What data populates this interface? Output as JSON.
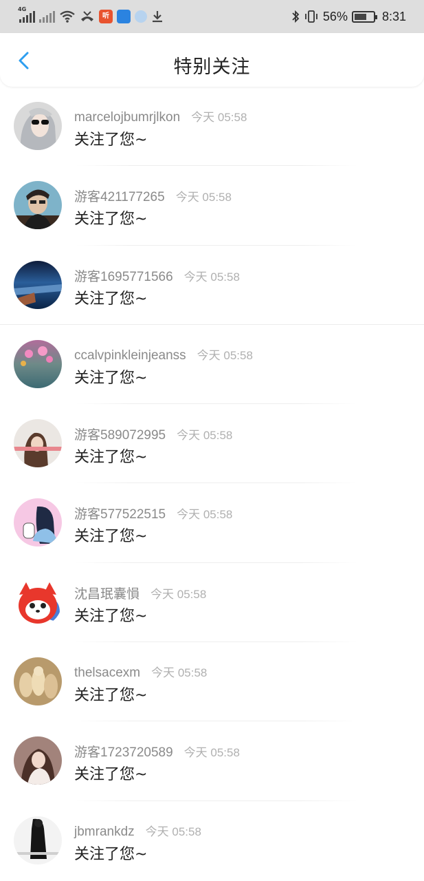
{
  "status_bar": {
    "net1": "4G",
    "battery": "56%",
    "time": "8:31",
    "icons": [
      "signal-4g-icon",
      "signal-x-icon",
      "wifi-icon",
      "missed-call-icon",
      "app-ting-icon",
      "shield-app-icon",
      "browser-icon",
      "download-icon",
      "bluetooth-icon",
      "vibrate-icon",
      "battery-icon"
    ]
  },
  "header": {
    "title": "特别关注",
    "back_icon": "chevron-left-icon",
    "accent": "#2d9ef0"
  },
  "rows": [
    {
      "name": "marcelojbumrjlkon",
      "time": "今天 05:58",
      "action": "关注了您~"
    },
    {
      "name": "游客421177265",
      "time": "今天 05:58",
      "action": "关注了您~"
    },
    {
      "name": "游客1695771566",
      "time": "今天 05:58",
      "action": "关注了您~"
    },
    {
      "name": "ccalvpinkleinjeanss",
      "time": "今天 05:58",
      "action": "关注了您~"
    },
    {
      "name": "游客589072995",
      "time": "今天 05:58",
      "action": "关注了您~"
    },
    {
      "name": "游客577522515",
      "time": "今天 05:58",
      "action": "关注了您~"
    },
    {
      "name": "沈昌珉囊愪",
      "time": "今天 05:58",
      "action": "关注了您~"
    },
    {
      "name": "thelsacexm",
      "time": "今天 05:58",
      "action": "关注了您~"
    },
    {
      "name": "游客1723720589",
      "time": "今天 05:58",
      "action": "关注了您~"
    },
    {
      "name": "jbmrankdz",
      "time": "今天 05:58",
      "action": "关注了您~"
    }
  ]
}
